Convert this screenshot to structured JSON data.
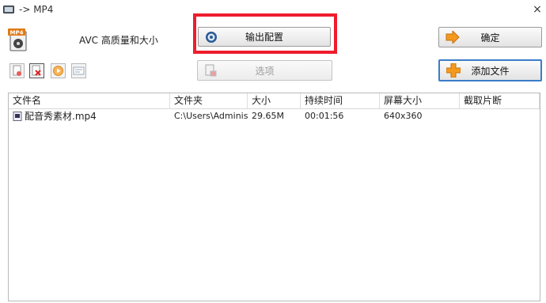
{
  "window": {
    "title": "-> MP4",
    "close_glyph": "×"
  },
  "format": {
    "label": "AVC 高质量和大小",
    "icon_text": "MP4"
  },
  "buttons": {
    "output_config": "输出配置",
    "options": "选项",
    "ok": "确定",
    "add_file": "添加文件"
  },
  "file_list": {
    "columns": [
      "文件名",
      "文件夹",
      "大小",
      "持续时间",
      "屏幕大小",
      "截取片断"
    ],
    "rows": [
      {
        "name": "配音秀素材.mp4",
        "folder": "C:\\Users\\Administ...",
        "size": "29.65M",
        "duration": "00:01:56",
        "screen_size": "640x360",
        "clip": ""
      }
    ]
  },
  "colors": {
    "highlight_box": "#ee1d2d",
    "focus_border": "#3b7cc9",
    "accent_orange": "#f39a1e"
  }
}
